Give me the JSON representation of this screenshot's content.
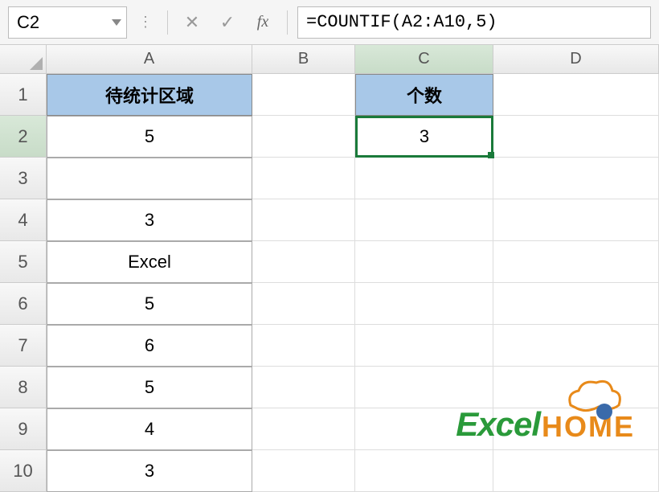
{
  "formula_bar": {
    "name_box_value": "C2",
    "formula_value": "=COUNTIF(A2:A10,5)"
  },
  "columns": [
    "A",
    "B",
    "C",
    "D"
  ],
  "rows": [
    "1",
    "2",
    "3",
    "4",
    "5",
    "6",
    "7",
    "8",
    "9",
    "10"
  ],
  "active_cell": "C2",
  "cells": {
    "A1": {
      "value": "待统计区域",
      "style": "header"
    },
    "A2": {
      "value": "5",
      "style": "data"
    },
    "A3": {
      "value": "",
      "style": "data"
    },
    "A4": {
      "value": "3",
      "style": "data"
    },
    "A5": {
      "value": "Excel",
      "style": "data"
    },
    "A6": {
      "value": "5",
      "style": "data"
    },
    "A7": {
      "value": "6",
      "style": "data"
    },
    "A8": {
      "value": "5",
      "style": "data"
    },
    "A9": {
      "value": "4",
      "style": "data"
    },
    "A10": {
      "value": "3",
      "style": "data"
    },
    "C1": {
      "value": "个数",
      "style": "header"
    },
    "C2": {
      "value": "3",
      "style": "data",
      "selected": true
    }
  },
  "watermark": {
    "text1": "Excel",
    "text2": "HOME"
  },
  "icons": {
    "cancel": "✕",
    "enter": "✓",
    "fx": "fx",
    "dots": "⋮"
  }
}
